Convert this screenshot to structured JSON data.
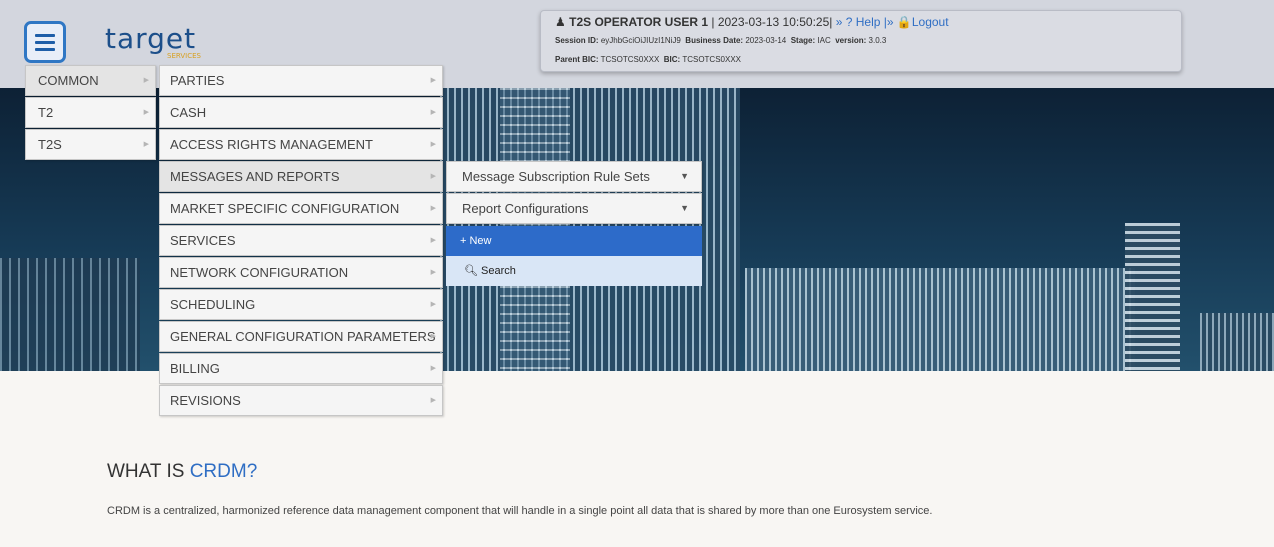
{
  "header": {
    "logo_text": "target",
    "logo_sub": "SERVICES",
    "session": {
      "user_name": "T2S OPERATOR USER 1",
      "datetime": "| 2023-03-13 10:50:25|",
      "help_label": "» ? Help",
      "separator": "|»",
      "logout_label": "Logout",
      "session_id_label": "Session ID:",
      "session_id": "eyJhbGciOiJIUzI1NiJ9",
      "business_date_label": "Business Date:",
      "business_date": "2023-03-14",
      "stage_label": "Stage:",
      "stage": "IAC",
      "version_label": "version:",
      "version": "3.0.3",
      "parent_bic_label": "Parent BIC:",
      "parent_bic": "TCSOTCS0XXX",
      "bic_label": "BIC:",
      "bic": "TCSOTCS0XXX"
    }
  },
  "menu": {
    "level1": [
      {
        "label": "COMMON"
      },
      {
        "label": "T2"
      },
      {
        "label": "T2S"
      }
    ],
    "level2": [
      {
        "label": "PARTIES"
      },
      {
        "label": "CASH"
      },
      {
        "label": "ACCESS RIGHTS MANAGEMENT"
      },
      {
        "label": "MESSAGES AND REPORTS"
      },
      {
        "label": "MARKET SPECIFIC CONFIGURATION"
      },
      {
        "label": "SERVICES"
      },
      {
        "label": "NETWORK CONFIGURATION"
      },
      {
        "label": "SCHEDULING"
      },
      {
        "label": "GENERAL CONFIGURATION PARAMETERS"
      },
      {
        "label": "BILLING"
      },
      {
        "label": "REVISIONS"
      }
    ],
    "level3": [
      {
        "label": "Message Subscription Rule Sets"
      },
      {
        "label": "Report Configurations"
      }
    ],
    "actions": {
      "new_label": "+ New",
      "search_label": "Search"
    }
  },
  "content": {
    "title_prefix": "WHAT IS ",
    "title_accent": "CRDM?",
    "paragraph": "CRDM is a centralized, harmonized reference data management component that will handle in a single point all data that is shared by more than one Eurosystem service."
  }
}
